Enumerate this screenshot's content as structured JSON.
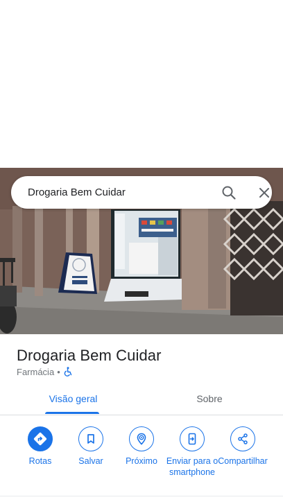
{
  "search": {
    "query": "Drogaria Bem Cuidar"
  },
  "place": {
    "name": "Drogaria Bem Cuidar",
    "category": "Farmácia",
    "separator": "•"
  },
  "tabs": [
    {
      "label": "Visão geral",
      "active": true
    },
    {
      "label": "Sobre",
      "active": false
    }
  ],
  "actions": [
    {
      "label": "Rotas",
      "icon": "directions-icon"
    },
    {
      "label": "Salvar",
      "icon": "bookmark-icon"
    },
    {
      "label": "Próximo",
      "icon": "nearby-icon"
    },
    {
      "label": "Enviar para o smartphone",
      "icon": "send-to-phone-icon"
    },
    {
      "label": "Compartilhar",
      "icon": "share-icon"
    }
  ],
  "colors": {
    "accent": "#1a73e8",
    "text_primary": "#202124",
    "text_secondary": "#70757a"
  }
}
